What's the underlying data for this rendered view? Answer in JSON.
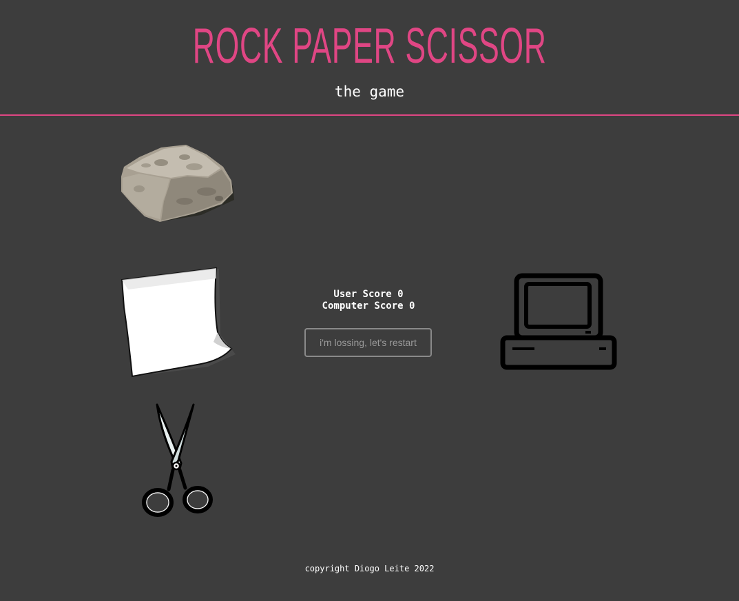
{
  "header": {
    "title": "ROCK PAPER SCISSOR",
    "subtitle": "the game"
  },
  "choices": [
    {
      "name": "rock",
      "icon": "rock-icon"
    },
    {
      "name": "paper",
      "icon": "paper-icon"
    },
    {
      "name": "scissor",
      "icon": "scissors-icon"
    }
  ],
  "opponent": {
    "icon": "computer-icon"
  },
  "scores": {
    "user_label": "User Score",
    "user_value": "0",
    "computer_label": "Computer Score",
    "computer_value": "0"
  },
  "restart_button": {
    "label": "i'm lossing, let's restart"
  },
  "footer": {
    "copyright": "copyright Diogo Leite 2022"
  },
  "colors": {
    "background": "#3d3d3d",
    "accent": "#e04684",
    "text": "#ffffff"
  }
}
